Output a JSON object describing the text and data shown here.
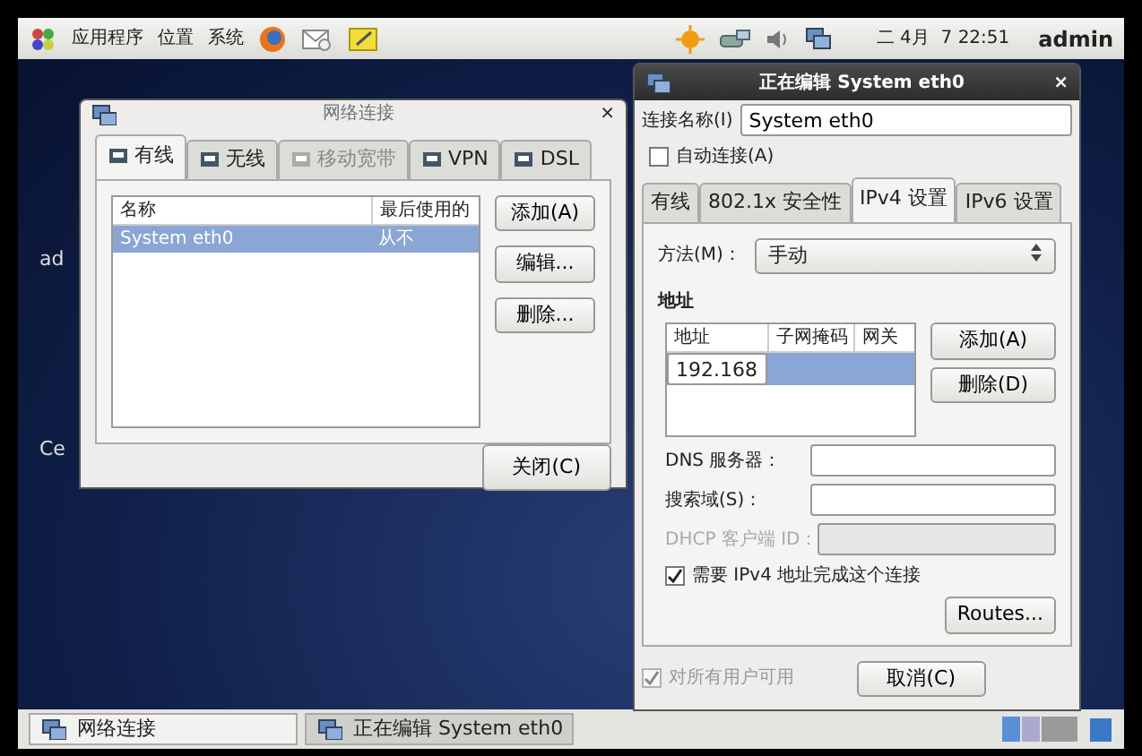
{
  "top_panel": {
    "menus": [
      "应用程序",
      "位置",
      "系统"
    ],
    "clock": "二 4月  7 22:51",
    "user": "admin"
  },
  "desktop_labels": [
    "ad",
    "Ce"
  ],
  "connections_window": {
    "title": "网络连接",
    "close_glyph": "×",
    "tabs": [
      {
        "label": "有线",
        "selected": true,
        "disabled": false
      },
      {
        "label": "无线",
        "selected": false,
        "disabled": false
      },
      {
        "label": "移动宽带",
        "selected": false,
        "disabled": true
      },
      {
        "label": "VPN",
        "selected": false,
        "disabled": false
      },
      {
        "label": "DSL",
        "selected": false,
        "disabled": false
      }
    ],
    "columns": [
      "名称",
      "最后使用的"
    ],
    "rows": [
      {
        "name": "System eth0",
        "last_used": "从不",
        "selected": true
      }
    ],
    "buttons": [
      "添加(A)",
      "编辑...",
      "删除..."
    ],
    "close_button": "关闭(C)"
  },
  "editor_window": {
    "title": "正在编辑 System eth0",
    "close_glyph": "×",
    "name_label": "连接名称(I)",
    "name_value": "System eth0",
    "autoconnect": {
      "label": "自动连接(A)",
      "checked": false
    },
    "tabs": [
      {
        "label": "有线",
        "selected": false
      },
      {
        "label": "802.1x 安全性",
        "selected": false
      },
      {
        "label": "IPv4 设置",
        "selected": true
      },
      {
        "label": "IPv6 设置",
        "selected": false
      }
    ],
    "method_label": "方法(M)：",
    "method_value": "手动",
    "address_heading": "地址",
    "address_columns": [
      "地址",
      "子网掩码",
      "网关"
    ],
    "address_rows": [
      {
        "address": "192.168",
        "selected": true
      }
    ],
    "address_buttons": [
      "添加(A)",
      "删除(D)"
    ],
    "fields": [
      {
        "label": "DNS 服务器：",
        "disabled": false
      },
      {
        "label": "搜索域(S)：",
        "disabled": false
      },
      {
        "label": "DHCP 客户端 ID：",
        "disabled": true
      }
    ],
    "require_ipv4": {
      "label": "需要 IPv4 地址完成这个连接",
      "checked": true
    },
    "routes_button": "Routes...",
    "all_users": {
      "label": "对所有用户可用",
      "checked": true,
      "disabled": true
    },
    "cancel_button": "取消(C)"
  },
  "taskbar": [
    {
      "label": "网络连接",
      "selected": false
    },
    {
      "label": "正在编辑 System eth0",
      "selected": true
    }
  ]
}
